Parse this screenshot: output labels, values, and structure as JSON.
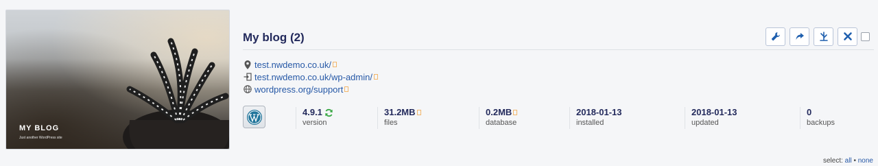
{
  "site": {
    "title": "My blog (2)",
    "thumbnail": {
      "title": "MY BLOG",
      "subtitle": "Just another WordPress site"
    }
  },
  "toolbar": {
    "buttons": [
      {
        "name": "tools-button",
        "icon": "wrench-icon"
      },
      {
        "name": "login-button",
        "icon": "share-arrow-icon"
      },
      {
        "name": "clone-button",
        "icon": "fork-icon"
      },
      {
        "name": "delete-button",
        "icon": "close-icon"
      }
    ]
  },
  "links": [
    {
      "icon": "location-pin-icon",
      "text": "test.nwdemo.co.uk/"
    },
    {
      "icon": "login-icon",
      "text": "test.nwdemo.co.uk/wp-admin/"
    },
    {
      "icon": "globe-icon",
      "text": "wordpress.org/support"
    }
  ],
  "stats": [
    {
      "value": "4.9.1",
      "label": "version"
    },
    {
      "value": "31.2MB",
      "label": "files"
    },
    {
      "value": "0.2MB",
      "label": "database"
    },
    {
      "value": "2018-01-13",
      "label": "installed"
    },
    {
      "value": "2018-01-13",
      "label": "updated"
    },
    {
      "value": "0",
      "label": "backups"
    }
  ],
  "select": {
    "prefix": "select:",
    "all": "all",
    "separator": "•",
    "none": "none"
  },
  "colors": {
    "title": "#232a5c",
    "link": "#2658a6",
    "accent_blue": "#1f5fae",
    "refresh_green": "#3aa845",
    "external_marker": "#f2b66b"
  }
}
